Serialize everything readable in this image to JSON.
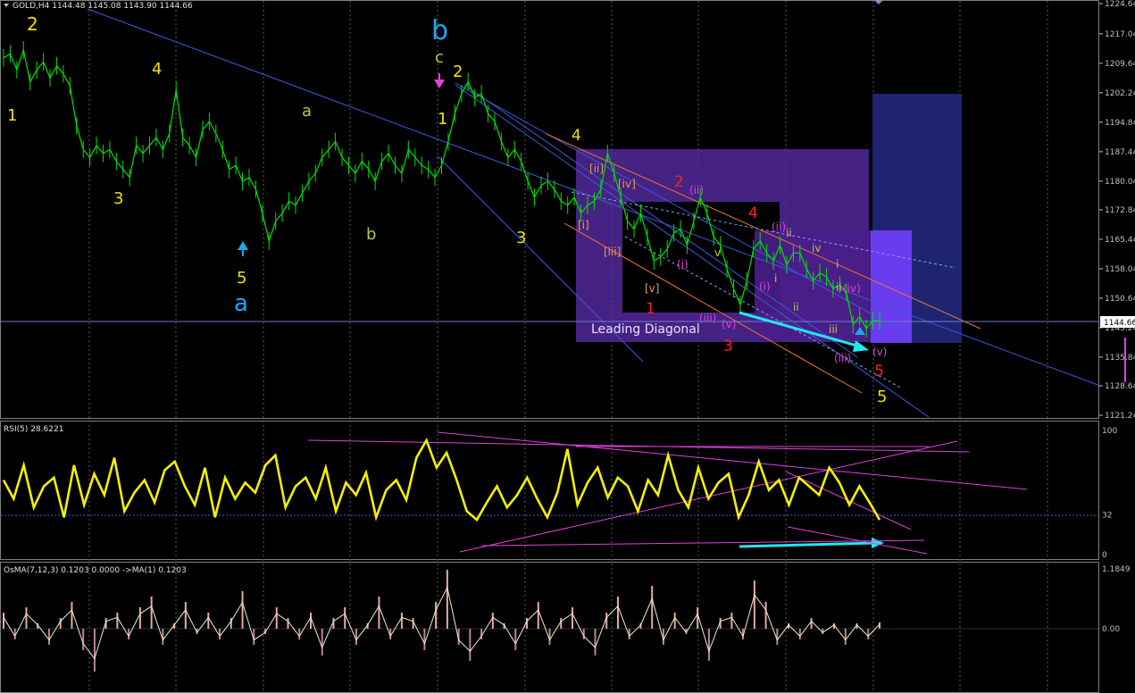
{
  "title": "GOLD,H4  1144.48 1145.08 1143.90 1144.66",
  "current_price": "1144.66",
  "colors": {
    "background": "#000000",
    "candle": "#00e000",
    "trend_line": "#3a5bd9",
    "channel_orange": "#e8762a",
    "box_purple": "#5a2ca8",
    "box_navy": "#1e2470",
    "box_violet": "#6a3cf0",
    "wave_yellow": "#f5e000",
    "wave_cyan": "#1aa8f0",
    "wave_red": "#ff2020",
    "wave_magenta": "#e040e0",
    "wave_olive": "#b8c840",
    "rsi_line": "#f5f000",
    "rsi_trend": "#e040e0",
    "osma_hist": "#e8a8a8",
    "osma_line": "#f0f0c0",
    "arrow_cyan": "#20e8f0"
  },
  "price_axis": {
    "ticks": [
      "1224.64",
      "1217.04",
      "1209.64",
      "1202.24",
      "1194.84",
      "1187.44",
      "1180.04",
      "1172.84",
      "1165.44",
      "1158.04",
      "1150.64",
      "1143.24",
      "1135.84",
      "1128.64",
      "1121.24"
    ]
  },
  "annotations": {
    "leading_diagonal": "Leading Diagonal",
    "wave_a": "a",
    "wave_b": "b",
    "wave_c": "c"
  },
  "chart_data": [
    {
      "type": "line",
      "title": "GOLD,H4",
      "series": [
        {
          "name": "GOLD",
          "values": [
            1211,
            1212,
            1208,
            1213,
            1205,
            1208,
            1210,
            1206,
            1209,
            1207,
            1204,
            1194,
            1188,
            1186,
            1189,
            1187,
            1188,
            1185,
            1183,
            1181,
            1189,
            1187,
            1189,
            1191,
            1188,
            1192,
            1203,
            1191,
            1189,
            1186,
            1193,
            1195,
            1192,
            1188,
            1183,
            1184,
            1180,
            1181,
            1178,
            1172,
            1165,
            1170,
            1172,
            1175,
            1174,
            1177,
            1180,
            1182,
            1186,
            1188,
            1190,
            1186,
            1184,
            1182,
            1185,
            1183,
            1180,
            1185,
            1187,
            1184,
            1182,
            1188,
            1186,
            1184,
            1183,
            1181,
            1184,
            1190,
            1197,
            1202,
            1205,
            1201,
            1202,
            1197,
            1195,
            1190,
            1186,
            1188,
            1185,
            1180,
            1176,
            1179,
            1180,
            1178,
            1175,
            1174,
            1176,
            1172,
            1174,
            1175,
            1178,
            1187,
            1182,
            1176,
            1170,
            1168,
            1172,
            1166,
            1160,
            1161,
            1163,
            1167,
            1168,
            1164,
            1170,
            1176,
            1172,
            1166,
            1164,
            1158,
            1153,
            1149,
            1155,
            1163,
            1165,
            1162,
            1160,
            1164,
            1159,
            1162,
            1162,
            1158,
            1155,
            1157,
            1156,
            1153,
            1154,
            1152,
            1144,
            1146,
            1143,
            1145,
            1145
          ]
        }
      ],
      "ylim": [
        1121.24,
        1224.64
      ],
      "ytick_labels": [
        "1224.64",
        "1217.04",
        "1209.64",
        "1202.24",
        "1194.84",
        "1187.44",
        "1180.04",
        "1172.84",
        "1165.44",
        "1158.04",
        "1150.64",
        "1143.24",
        "1135.84",
        "1128.64",
        "1121.24"
      ],
      "grid": true,
      "wave_labels": [
        {
          "text": "2",
          "color": "yellow"
        },
        {
          "text": "1",
          "color": "yellow"
        },
        {
          "text": "3",
          "color": "yellow"
        },
        {
          "text": "4",
          "color": "yellow"
        },
        {
          "text": "5",
          "color": "yellow"
        },
        {
          "text": "a",
          "color": "cyan"
        },
        {
          "text": "a",
          "color": "olive"
        },
        {
          "text": "b",
          "color": "olive"
        },
        {
          "text": "b",
          "color": "cyan"
        },
        {
          "text": "c",
          "color": "olive"
        },
        {
          "text": "2",
          "color": "yellow"
        },
        {
          "text": "1",
          "color": "yellow"
        },
        {
          "text": "4",
          "color": "yellow"
        },
        {
          "text": "3",
          "color": "yellow"
        },
        {
          "text": "[ii]",
          "color": "orange"
        },
        {
          "text": "[iv]",
          "color": "orange"
        },
        {
          "text": "[i]",
          "color": "orange"
        },
        {
          "text": "[iii]",
          "color": "orange"
        },
        {
          "text": "[v]",
          "color": "orange"
        },
        {
          "text": "1",
          "color": "red"
        },
        {
          "text": "2",
          "color": "red"
        },
        {
          "text": "(ii)",
          "color": "magenta"
        },
        {
          "text": "(i)",
          "color": "magenta"
        },
        {
          "text": "4",
          "color": "red"
        },
        {
          "text": "(ii)",
          "color": "magenta"
        },
        {
          "text": "(i)",
          "color": "magenta"
        },
        {
          "text": "(iii)",
          "color": "magenta"
        },
        {
          "text": "(v)",
          "color": "magenta"
        },
        {
          "text": "3",
          "color": "red"
        },
        {
          "text": "v",
          "color": "olive"
        },
        {
          "text": "ii",
          "color": "olive"
        },
        {
          "text": "iv",
          "color": "olive"
        },
        {
          "text": "i",
          "color": "olive"
        },
        {
          "text": "ii",
          "color": "olive"
        },
        {
          "text": "i",
          "color": "olive"
        },
        {
          "text": "ii",
          "color": "olive"
        },
        {
          "text": "iii",
          "color": "olive"
        },
        {
          "text": "(iv)",
          "color": "magenta"
        },
        {
          "text": "(v)",
          "color": "magenta"
        },
        {
          "text": "(iii)",
          "color": "magenta"
        },
        {
          "text": "5",
          "color": "red"
        },
        {
          "text": "5",
          "color": "yellow"
        }
      ]
    },
    {
      "type": "line",
      "title": "RSI(5) 28.6221",
      "series": [
        {
          "name": "RSI(5)",
          "values": [
            60,
            45,
            72,
            38,
            55,
            62,
            30,
            72,
            40,
            65,
            48,
            78,
            35,
            50,
            60,
            42,
            68,
            75,
            55,
            40,
            70,
            30,
            62,
            45,
            58,
            50,
            72,
            80,
            38,
            55,
            62,
            45,
            70,
            35,
            58,
            48,
            66,
            30,
            52,
            60,
            44,
            78,
            92,
            70,
            82,
            60,
            35,
            28,
            42,
            55,
            38,
            48,
            62,
            45,
            30,
            50,
            85,
            40,
            58,
            70,
            46,
            62,
            55,
            35,
            60,
            48,
            80,
            52,
            38,
            70,
            45,
            58,
            65,
            30,
            48,
            75,
            52,
            60,
            40,
            62,
            55,
            48,
            70,
            58,
            40,
            55,
            42,
            28
          ]
        }
      ],
      "ylim": [
        0,
        100
      ],
      "ytick_labels": [
        "100",
        "32",
        "0"
      ]
    },
    {
      "type": "bar",
      "title": "OsMA(7,12,3) 0.1203 0.0000  ->MA(1) 0.1203",
      "series": [
        {
          "name": "OsMA(7,12,3)",
          "values": [
            0.3,
            -0.2,
            0.4,
            0.1,
            -0.3,
            0.2,
            0.5,
            -0.4,
            -0.8,
            0.2,
            0.3,
            -0.2,
            0.4,
            0.6,
            -0.3,
            0.1,
            0.5,
            -0.1,
            0.3,
            -0.2,
            0.2,
            0.7,
            -0.3,
            -0.1,
            0.4,
            0.2,
            -0.2,
            0.3,
            -0.5,
            0.2,
            0.4,
            -0.3,
            0.1,
            0.6,
            -0.2,
            0.3,
            0.2,
            -0.4,
            0.5,
            1.1,
            -0.3,
            -0.6,
            -0.2,
            0.3,
            0.1,
            -0.4,
            0.2,
            0.5,
            -0.3,
            0.2,
            0.4,
            -0.2,
            -0.5,
            0.3,
            0.6,
            -0.2,
            0.1,
            0.8,
            -0.3,
            0.3,
            -0.1,
            0.4,
            -0.6,
            0.2,
            0.3,
            -0.2,
            0.9,
            0.5,
            -0.3,
            0.1,
            -0.2,
            0.2,
            -0.1,
            0.1,
            -0.3,
            0.1,
            -0.2,
            0.12
          ]
        }
      ],
      "ytick_labels": [
        "1.1849",
        "0.00"
      ]
    }
  ]
}
